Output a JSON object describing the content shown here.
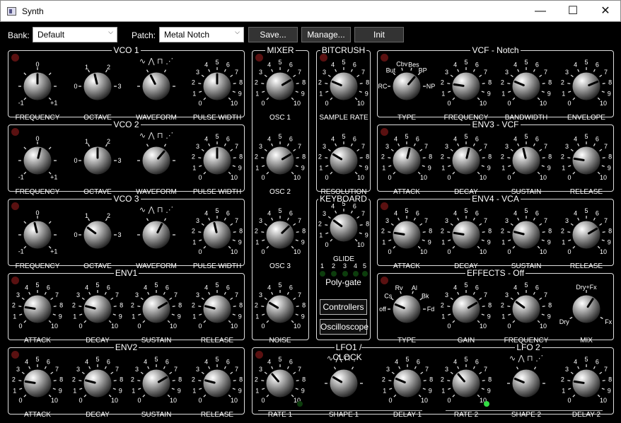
{
  "window": {
    "title": "Synth",
    "minimize": "—",
    "maximize": "☐",
    "close": "✕"
  },
  "toolbar": {
    "bank_label": "Bank:",
    "bank_value": "Default",
    "patch_label": "Patch:",
    "patch_value": "Metal Notch",
    "save": "Save...",
    "manage": "Manage...",
    "init": "Init"
  },
  "sections": {
    "vco1": "VCO 1",
    "vco2": "VCO 2",
    "vco3": "VCO 3",
    "env1": "ENV1",
    "env2": "ENV2",
    "mixer": "MIXER",
    "bitcrush": "BITCRUSH",
    "keyboard": "KEYBOARD",
    "vcf": "VCF - Notch",
    "env3": "ENV3 - VCF",
    "env4": "ENV4 - VCA",
    "effects": "EFFECTS - Off",
    "lfo_clock": "LFO1 / CLOCK",
    "lfo2": "LFO 2"
  },
  "scale": {
    "s0": "0",
    "s1": "1",
    "s2": "2",
    "s3": "3",
    "s4": "4",
    "s5": "5",
    "s6": "6",
    "s7": "7",
    "s8": "8",
    "s9": "9",
    "s10": "10"
  },
  "marks": {
    "fq_lo": "-1",
    "fq_mid": "0",
    "fq_hi": "+1",
    "oct_lo": "0",
    "oct_1": "1",
    "oct_2": "2",
    "oct_hi": "3"
  },
  "waveform_icons": "∿ ⋀ ⊓ ⋰",
  "vcf_types": {
    "rc": "RC",
    "but": "But",
    "cbv": "Cbv",
    "bes": "Bes",
    "bp": "BP",
    "np": "NP"
  },
  "fx_types": {
    "off": "off",
    "cs": "Cs",
    "rv": "Rv",
    "al": "Al",
    "bk": "Bk",
    "fd": "Fd"
  },
  "mix_marks": {
    "dry": "Dry",
    "dryfx": "Dry+Fx",
    "fx": "Fx"
  },
  "labels": {
    "frequency": "FREQUENCY",
    "octave": "OCTAVE",
    "waveform": "WAVEFORM",
    "pulse_width": "PULSE WIDTH",
    "attack": "ATTACK",
    "decay": "DECAY",
    "sustain": "SUSTAIN",
    "release": "RELEASE",
    "osc1": "OSC 1",
    "osc2": "OSC 2",
    "osc3": "OSC 3",
    "noise": "NOISE",
    "sample_rate": "SAMPLE RATE",
    "resolution": "RESOLUTION",
    "glide": "GLIDE",
    "type": "TYPE",
    "bandwidth": "BANDWIDTH",
    "envelope": "ENVELOPE",
    "gain": "GAIN",
    "mix": "MIX",
    "rate1": "RATE 1",
    "shape1": "SHAPE 1",
    "delay1": "DELAY 1",
    "rate2": "RATE 2",
    "shape2": "SHAPE 2",
    "delay2": "DELAY 2"
  },
  "keyboard": {
    "poly_numbers": [
      "1",
      "2",
      "3",
      "4",
      "5"
    ],
    "poly_gate": "Poly-gate",
    "controllers": "Controllers",
    "oscilloscope": "Oscilloscope"
  },
  "knob_values": {
    "vco1": [
      0.5,
      0.45,
      0.4,
      0.5
    ],
    "vco2": [
      0.55,
      0.5,
      0.65,
      0.5
    ],
    "vco3": [
      0.45,
      0.3,
      0.6,
      0.45
    ],
    "env1": [
      0.2,
      0.22,
      0.72,
      0.22
    ],
    "env2": [
      0.2,
      0.22,
      0.72,
      0.22
    ],
    "mixer": [
      0.72,
      0.72,
      0.67,
      0.28
    ],
    "bitcrush": [
      0.25,
      0.28
    ],
    "glide": 0.3,
    "vcf": [
      0.65,
      0.2,
      0.25,
      0.75
    ],
    "env3": [
      0.55,
      0.55,
      0.45,
      0.2
    ],
    "env4": [
      0.2,
      0.2,
      0.22,
      0.72
    ],
    "effects": [
      0.25,
      0.72,
      0.3,
      0.62
    ],
    "lfo1": [
      0.35,
      0.28,
      0.25
    ],
    "lfo2": [
      0.35,
      0.25,
      0.2
    ]
  },
  "led_state": {
    "rate1_led": "off",
    "rate2_led": "on",
    "poly_gate_leds": [
      "off",
      "off",
      "off",
      "off",
      "off"
    ]
  },
  "colors": {
    "led_off": "#5a1111",
    "green_on": "#33dd44",
    "panel_border": "#dddddd"
  }
}
